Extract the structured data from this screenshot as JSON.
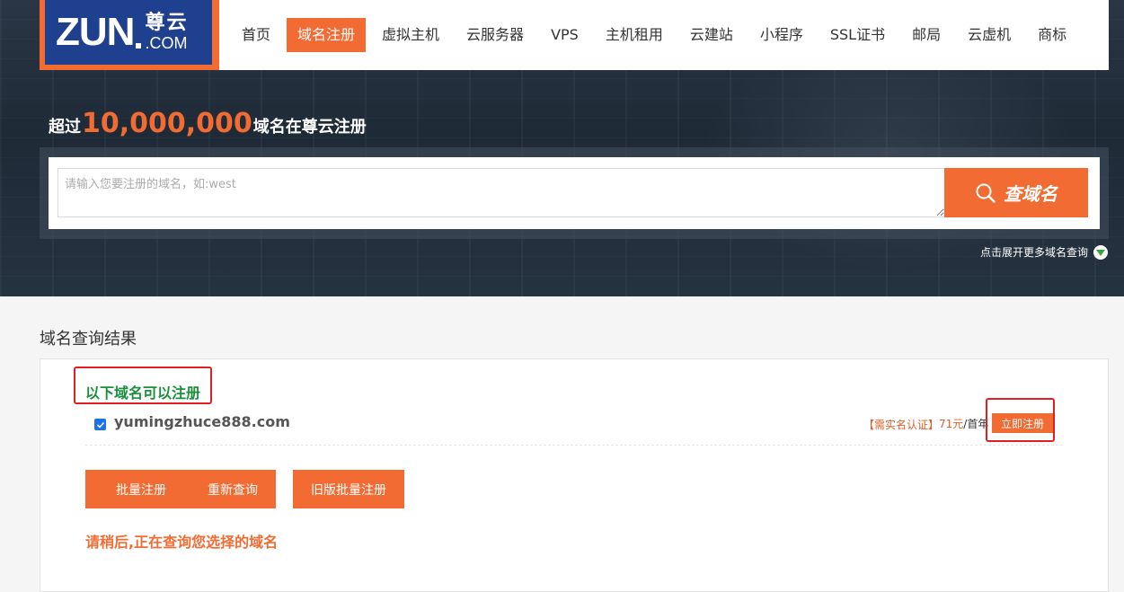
{
  "logo": {
    "brand": "ZUN",
    "cn": "尊云",
    "com": ".COM"
  },
  "nav": {
    "items": [
      "首页",
      "域名注册",
      "虚拟主机",
      "云服务器",
      "VPS",
      "主机租用",
      "云建站",
      "小程序",
      "SSL证书",
      "邮局",
      "云虚机",
      "商标"
    ],
    "active_index": 1
  },
  "hero": {
    "prefix": "超过",
    "count": "10,000,000",
    "suffix": "域名在尊云注册"
  },
  "search": {
    "placeholder": "请输入您要注册的域名，如:west",
    "button_label": "查域名",
    "expand_label": "点击展开更多域名查询"
  },
  "results": {
    "title": "域名查询结果",
    "available_title": "以下域名可以注册",
    "items": [
      {
        "domain": "yumingzhuce888.com",
        "checked": true,
        "auth_note": "【需实名认证】",
        "price": "71元",
        "price_unit": "/首年",
        "register_label": "立即注册"
      }
    ],
    "actions": [
      "批量注册",
      "重新查询",
      "旧版批量注册"
    ],
    "waiting_text": "请稍后,正在查询您选择的域名"
  },
  "colors": {
    "accent": "#f26b32",
    "logo_blue": "#1f3f8f",
    "available_green": "#1a8f3c",
    "highlight_red": "#e02020"
  }
}
